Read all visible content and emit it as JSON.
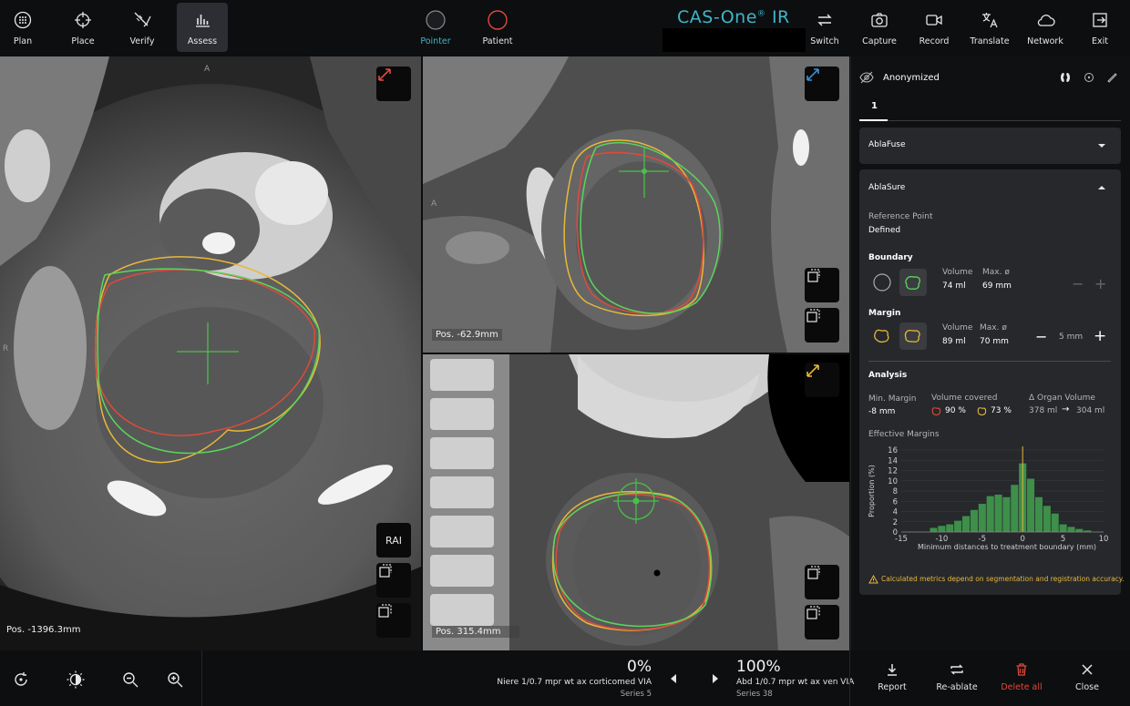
{
  "toolbar": {
    "left": [
      {
        "label": "Plan",
        "icon": "plan-icon"
      },
      {
        "label": "Place",
        "icon": "crosshair-icon"
      },
      {
        "label": "Verify",
        "icon": "verify-icon"
      },
      {
        "label": "Assess",
        "icon": "bar-chart-icon",
        "active": true
      }
    ],
    "center": [
      {
        "label": "Pointer",
        "color": "#2a2c30",
        "active": true
      },
      {
        "label": "Patient",
        "color": "#e04a3a"
      }
    ],
    "brand": "CAS-One",
    "brand_sup": "®",
    "brand_suffix": " IR",
    "right": [
      {
        "label": "Switch",
        "icon": "switch-arrows-icon"
      },
      {
        "label": "Capture",
        "icon": "camera-icon"
      },
      {
        "label": "Record",
        "icon": "video-icon"
      },
      {
        "label": "Translate",
        "icon": "translate-icon"
      },
      {
        "label": "Network",
        "icon": "cloud-icon"
      },
      {
        "label": "Exit",
        "icon": "exit-icon"
      }
    ]
  },
  "viewports": {
    "axial": {
      "pos": "Pos. -1396.3mm",
      "orient_top": "A",
      "orient_left": "R",
      "rai": "RAI"
    },
    "coronal": {
      "pos": "Pos. -62.9mm",
      "orient_left": "A"
    },
    "sagittal": {
      "pos": "Pos. 315.4mm"
    }
  },
  "panel": {
    "patient": "Anonymized",
    "tab": "1",
    "ablafuse": "AblaFuse",
    "ablasure": "AblaSure",
    "reference_point_label": "Reference Point",
    "reference_point_value": "Defined",
    "boundary": {
      "title": "Boundary",
      "volume_label": "Volume",
      "volume": "74 ml",
      "max_label": "Max. ø",
      "max": "69 mm"
    },
    "margin": {
      "title": "Margin",
      "volume_label": "Volume",
      "volume": "89 ml",
      "max_label": "Max. ø",
      "max": "70 mm",
      "margin_value": "5 mm"
    },
    "analysis": {
      "title": "Analysis",
      "min_margin_label": "Min. Margin",
      "min_margin": "-8 mm",
      "volume_covered_label": "Volume covered",
      "covered_boundary": "90 %",
      "covered_margin": "73 %",
      "organ_volume_label": "Δ Organ Volume",
      "organ_from": "378 ml",
      "organ_arrow": "→",
      "organ_to": "304 ml"
    },
    "effective_margins": "Effective Margins",
    "warning": "Calculated metrics depend on segmentation and registration accuracy.",
    "colors": {
      "accent": "#3fb6c8",
      "warning": "#e8b83a",
      "delete": "#e04a3a"
    }
  },
  "chart_data": {
    "type": "bar",
    "title": "Effective Margins",
    "xlabel": "Minimum distances to treatment boundary (mm)",
    "ylabel": "Proportion (%)",
    "xlim": [
      -15,
      10
    ],
    "ylim": [
      0,
      16
    ],
    "xticks": [
      -15,
      -10,
      -5,
      0,
      5,
      10
    ],
    "yticks": [
      0,
      2,
      4,
      6,
      8,
      10,
      12,
      14,
      16
    ],
    "x": [
      -11,
      -10,
      -9,
      -8,
      -7,
      -6,
      -5,
      -4,
      -3,
      -2,
      -1,
      0,
      1,
      2,
      3,
      4,
      5,
      6,
      7,
      8
    ],
    "values": [
      0.8,
      1.2,
      1.5,
      2.2,
      3.1,
      4.3,
      5.5,
      7.0,
      7.3,
      6.8,
      9.2,
      13.4,
      10.4,
      6.8,
      5.1,
      3.6,
      1.5,
      1.0,
      0.6,
      0.3
    ],
    "bar_color": "#3e8f4a",
    "reference_line": 0
  },
  "bottom": {
    "left_series": {
      "percent": "0%",
      "name": "Niere 1/0.7 mpr wt ax corticomed VIA",
      "series": "Series 5"
    },
    "right_series": {
      "percent": "100%",
      "name": "Abd 1/0.7 mpr wt ax ven VIA",
      "series": "Series 38"
    },
    "actions": [
      {
        "label": "Report",
        "icon": "download-icon"
      },
      {
        "label": "Re-ablate",
        "icon": "repeat-icon"
      },
      {
        "label": "Delete all",
        "icon": "trash-icon",
        "color": "#e04a3a"
      },
      {
        "label": "Close",
        "icon": "close-icon"
      }
    ]
  }
}
